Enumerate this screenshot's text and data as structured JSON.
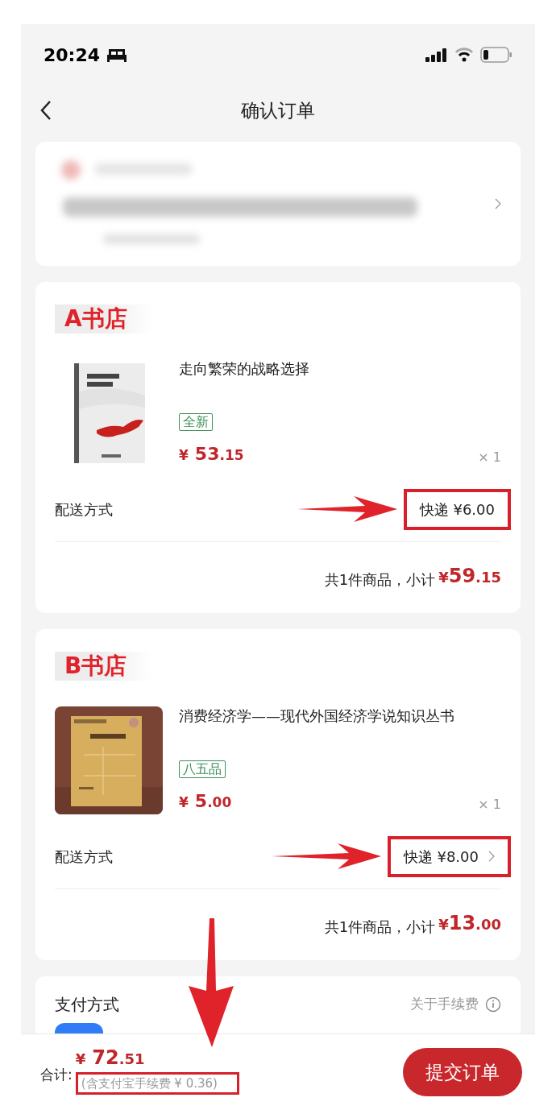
{
  "status_bar": {
    "time": "20:24"
  },
  "title": "确认订单",
  "stores": [
    {
      "name": "A书店",
      "item": {
        "title": "走向繁荣的战略选择",
        "condition": "全新",
        "price": {
          "currency": "¥",
          "integer": "53",
          "decimal": ".15"
        },
        "quantity": "× 1"
      },
      "shipping": {
        "label": "配送方式",
        "value": "快递 ¥6.00",
        "chevron": false,
        "highlighted": true
      },
      "summary": "共1件商品，小计",
      "subtotal": {
        "currency": "¥",
        "integer": "59",
        "decimal": ".15"
      }
    },
    {
      "name": "B书店",
      "item": {
        "title": "消费经济学——现代外国经济学说知识丛书",
        "condition": "八五品",
        "price": {
          "currency": "¥",
          "integer": "5",
          "decimal": ".00"
        },
        "quantity": "× 1"
      },
      "shipping": {
        "label": "配送方式",
        "value": "快递 ¥8.00",
        "chevron": true,
        "highlighted": true
      },
      "summary": "共1件商品，小计",
      "subtotal": {
        "currency": "¥",
        "integer": "13",
        "decimal": ".00"
      }
    }
  ],
  "payment": {
    "title": "支付方式",
    "fee_link": "关于手续费"
  },
  "footer": {
    "total_label": "合计:",
    "total": {
      "currency": "¥",
      "integer": "72",
      "decimal": ".51"
    },
    "fee_note": "(含支付宝手续费 ¥ 0.36)",
    "fee_note_highlighted": true,
    "submit": "提交订单"
  }
}
